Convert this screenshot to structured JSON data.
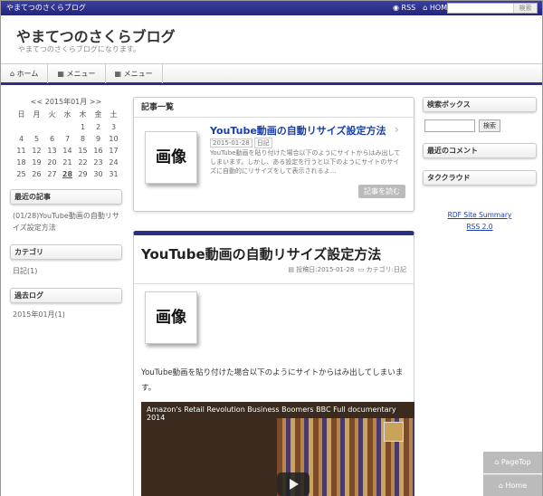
{
  "topbar": {
    "site": "やまてつのさくらブログ",
    "rss": "RSS",
    "home": "HOME",
    "search_button": "検索"
  },
  "header": {
    "title": "やまてつのさくらブログ",
    "subtitle": "やまてつのさくらブログになります。"
  },
  "nav": {
    "items": [
      "ホーム",
      "メニュー",
      "メニュー"
    ]
  },
  "calendar": {
    "title": "<< 2015年01月 >>",
    "days": [
      "日",
      "月",
      "火",
      "水",
      "木",
      "金",
      "土"
    ],
    "dates": [
      "",
      "",
      "",
      "",
      "1",
      "2",
      "3",
      "4",
      "5",
      "6",
      "7",
      "8",
      "9",
      "10",
      "11",
      "12",
      "13",
      "14",
      "15",
      "16",
      "17",
      "18",
      "19",
      "20",
      "21",
      "22",
      "23",
      "24",
      "25",
      "26",
      "27",
      "28",
      "29",
      "30",
      "31"
    ],
    "highlight": "28"
  },
  "left": {
    "recent_title": "最近の記事",
    "recent_item": "(01/28)YouTube動画の自動リサイズ設定方法",
    "category_title": "カテゴリ",
    "category_item": "日記(1)",
    "archive_title": "過去ログ",
    "archive_item": "2015年01月(1)"
  },
  "list": {
    "title": "記事一覧",
    "thumb": "画像",
    "entry_title": "YouTube動画の自動リサイズ設定方法",
    "date": "2015-01-28",
    "tag": "日記",
    "excerpt": "YouTube動画を貼り付けた場合以下のようにサイトからはみ出してしまいます。しかし、ある設定を行うと以下のようにサイトのサイズに自動的にリサイズをして表示されるよ…",
    "more": "記事を読む"
  },
  "article": {
    "title": "YouTube動画の自動リサイズ設定方法",
    "meta_date": "投稿日:2015-01-28",
    "meta_cat": "カテゴリ:日記",
    "thumb": "画像",
    "body": "YouTube動画を貼り付けた場合以下のようにサイトからはみ出してしまいます。",
    "video_title": "Amazon's Retail Revolution Business Boomers BBC Full documentary 2014"
  },
  "right": {
    "search_title": "検索ボックス",
    "search_button": "検索",
    "comment_title": "最近のコメント",
    "tag_title": "タククラウド",
    "rdf": "RDF Site Summary",
    "rss": "RSS 2.0"
  },
  "floating": {
    "pagetop": "PageTop",
    "home": "Home"
  }
}
